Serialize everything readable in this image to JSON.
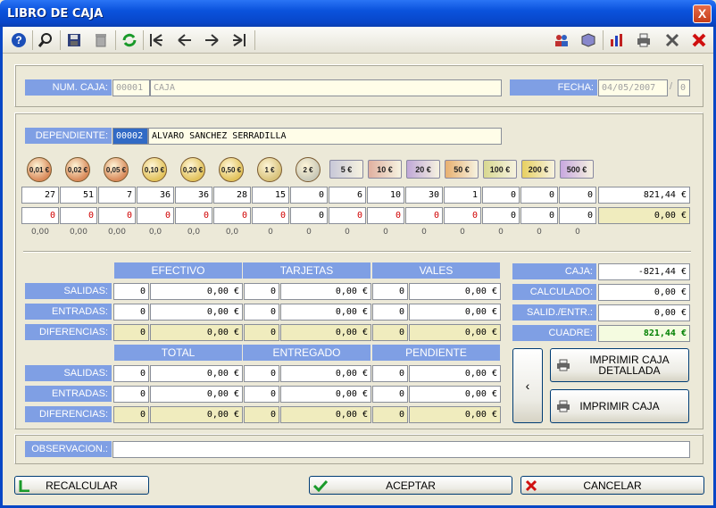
{
  "window": {
    "title": "LIBRO DE CAJA",
    "close": "X"
  },
  "toolbar": {
    "icons": [
      "help-icon",
      "search-icon",
      "save-icon",
      "trash-icon",
      "refresh-icon",
      "first-icon",
      "prev-icon",
      "next-icon",
      "last-icon",
      "users-icon",
      "cube-icon",
      "chart-icon",
      "printer-icon",
      "tools-icon",
      "close-icon"
    ]
  },
  "caja": {
    "num_label": "NUM. CAJA:",
    "num_value": "00001",
    "name": "CAJA",
    "fecha_label": "FECHA:",
    "fecha_value": "04/05/2007",
    "fecha_sep": "/",
    "fecha_extra": "0"
  },
  "dependiente": {
    "label": "DEPENDIENTE:",
    "code": "00002",
    "name": "ALVARO SANCHEZ SERRADILLA"
  },
  "denominations": [
    "0,01 €",
    "0,02 €",
    "0,05 €",
    "0,10 €",
    "0,20 €",
    "0,50 €",
    "1 €",
    "2 €",
    "5 €",
    "10 €",
    "20 €",
    "50 €",
    "100 €",
    "200 €",
    "500 €"
  ],
  "counts_row": [
    "27",
    "51",
    "7",
    "36",
    "36",
    "28",
    "15",
    "0",
    "6",
    "10",
    "30",
    "1",
    "0",
    "0",
    "0"
  ],
  "counts_total": "821,44 €",
  "second_row": [
    "0",
    "0",
    "0",
    "0",
    "0",
    "0",
    "0",
    "0",
    "0",
    "0",
    "0",
    "0",
    "0",
    "0",
    "0"
  ],
  "second_total": "0,00 €",
  "small_row": [
    "0,00",
    "0,00",
    "0,00",
    "0,0",
    "0,0",
    "0,0",
    "0",
    "0",
    "0",
    "0",
    "0",
    "0",
    "0",
    "0",
    "0"
  ],
  "grid1": {
    "headers": [
      "EFECTIVO",
      "TARJETAS",
      "VALES"
    ],
    "rows": [
      {
        "label": "SALIDAS:",
        "cells": [
          "0",
          "0,00 €",
          "0",
          "0,00 €",
          "0",
          "0,00 €"
        ]
      },
      {
        "label": "ENTRADAS:",
        "cells": [
          "0",
          "0,00 €",
          "0",
          "0,00 €",
          "0",
          "0,00 €"
        ]
      },
      {
        "label": "DIFERENCIAS:",
        "cells": [
          "0",
          "0,00 €",
          "0",
          "0,00 €",
          "0",
          "0,00 €"
        ]
      }
    ]
  },
  "grid2": {
    "headers": [
      "TOTAL",
      "ENTREGADO",
      "PENDIENTE"
    ],
    "rows": [
      {
        "label": "SALIDAS:",
        "cells": [
          "0",
          "0,00 €",
          "0",
          "0,00 €",
          "0",
          "0,00 €"
        ]
      },
      {
        "label": "ENTRADAS:",
        "cells": [
          "0",
          "0,00 €",
          "0",
          "0,00 €",
          "0",
          "0,00 €"
        ]
      },
      {
        "label": "DIFERENCIAS:",
        "cells": [
          "0",
          "0,00 €",
          "0",
          "0,00 €",
          "0",
          "0,00 €"
        ]
      }
    ]
  },
  "summary": [
    {
      "label": "CAJA:",
      "value": "-821,44 €"
    },
    {
      "label": "CALCULADO:",
      "value": "0,00 €"
    },
    {
      "label": "SALID./ENTR.:",
      "value": "0,00 €"
    },
    {
      "label": "CUADRE:",
      "value": "821,44 €"
    }
  ],
  "buttons": {
    "back": "‹",
    "print_detailed": "IMPRIMIR CAJA DETALLADA",
    "print": "IMPRIMIR CAJA",
    "recalcular": "RECALCULAR",
    "aceptar": "ACEPTAR",
    "cancelar": "CANCELAR"
  },
  "observacion": {
    "label": "OBSERVACION.:",
    "value": ""
  },
  "colors": {
    "label_bg": "#7f9fe4",
    "field_bg": "#fffde8",
    "cuadre_text": "#008000",
    "zero_red": "#d00000"
  }
}
